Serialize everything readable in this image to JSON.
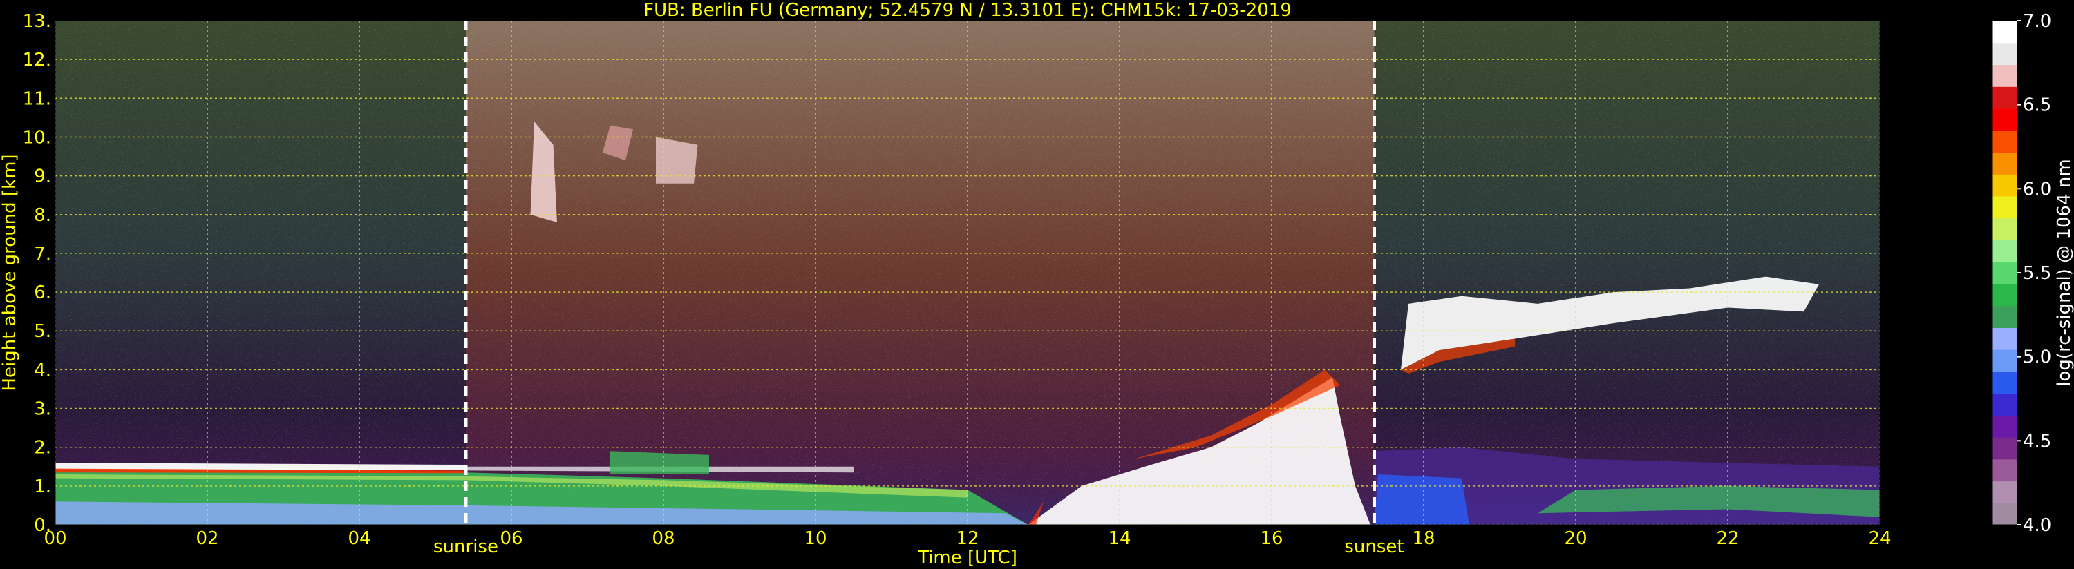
{
  "chart_data": {
    "type": "heatmap",
    "title": "FUB: Berlin FU (Germany; 52.4579 N / 13.3101 E):    CHM15k: 17-03-2019",
    "xlabel": "Time [UTC]",
    "ylabel": "Height above ground [km]",
    "xlim": [
      0,
      24
    ],
    "ylim": [
      0,
      13
    ],
    "x_ticks": [
      0,
      2,
      4,
      6,
      8,
      10,
      12,
      14,
      16,
      18,
      20,
      22,
      24
    ],
    "x_tick_labels": [
      "00",
      "02",
      "04",
      "06",
      "08",
      "10",
      "12",
      "14",
      "16",
      "18",
      "20",
      "22",
      "24"
    ],
    "y_ticks": [
      0,
      1,
      2,
      3,
      4,
      5,
      6,
      7,
      8,
      9,
      10,
      11,
      12,
      13
    ],
    "y_tick_labels": [
      "0.",
      "1.",
      "2.",
      "3.",
      "4.",
      "5.",
      "6.",
      "7.",
      "8.",
      "9.",
      "10.",
      "11.",
      "12.",
      "13."
    ],
    "grid": true,
    "annotations": [
      {
        "name": "sunrise",
        "x": 5.4,
        "label": "sunrise"
      },
      {
        "name": "sunset",
        "x": 17.35,
        "label": "sunset"
      }
    ],
    "colorbar": {
      "label": "log(rc-signal) @ 1064 nm",
      "range": [
        4.0,
        7.0
      ],
      "ticks": [
        4.0,
        4.5,
        5.0,
        5.5,
        6.0,
        6.5,
        7.0
      ],
      "tick_labels": [
        "4.0",
        "4.5",
        "5.0",
        "5.5",
        "6.0",
        "6.5",
        "7.0"
      ],
      "colors": [
        "#a08ca0",
        "#b08fb0",
        "#9a5a9a",
        "#7a2a8a",
        "#6a1aa6",
        "#3a2ad0",
        "#2a5af0",
        "#6a9af8",
        "#9ab0ff",
        "#3aa05a",
        "#2ab84a",
        "#5ad870",
        "#9af090",
        "#c8f060",
        "#f0f020",
        "#f8c800",
        "#f89000",
        "#f85000",
        "#f80000",
        "#d81818",
        "#f0c0c0",
        "#e8e8e8",
        "#ffffff"
      ]
    }
  }
}
